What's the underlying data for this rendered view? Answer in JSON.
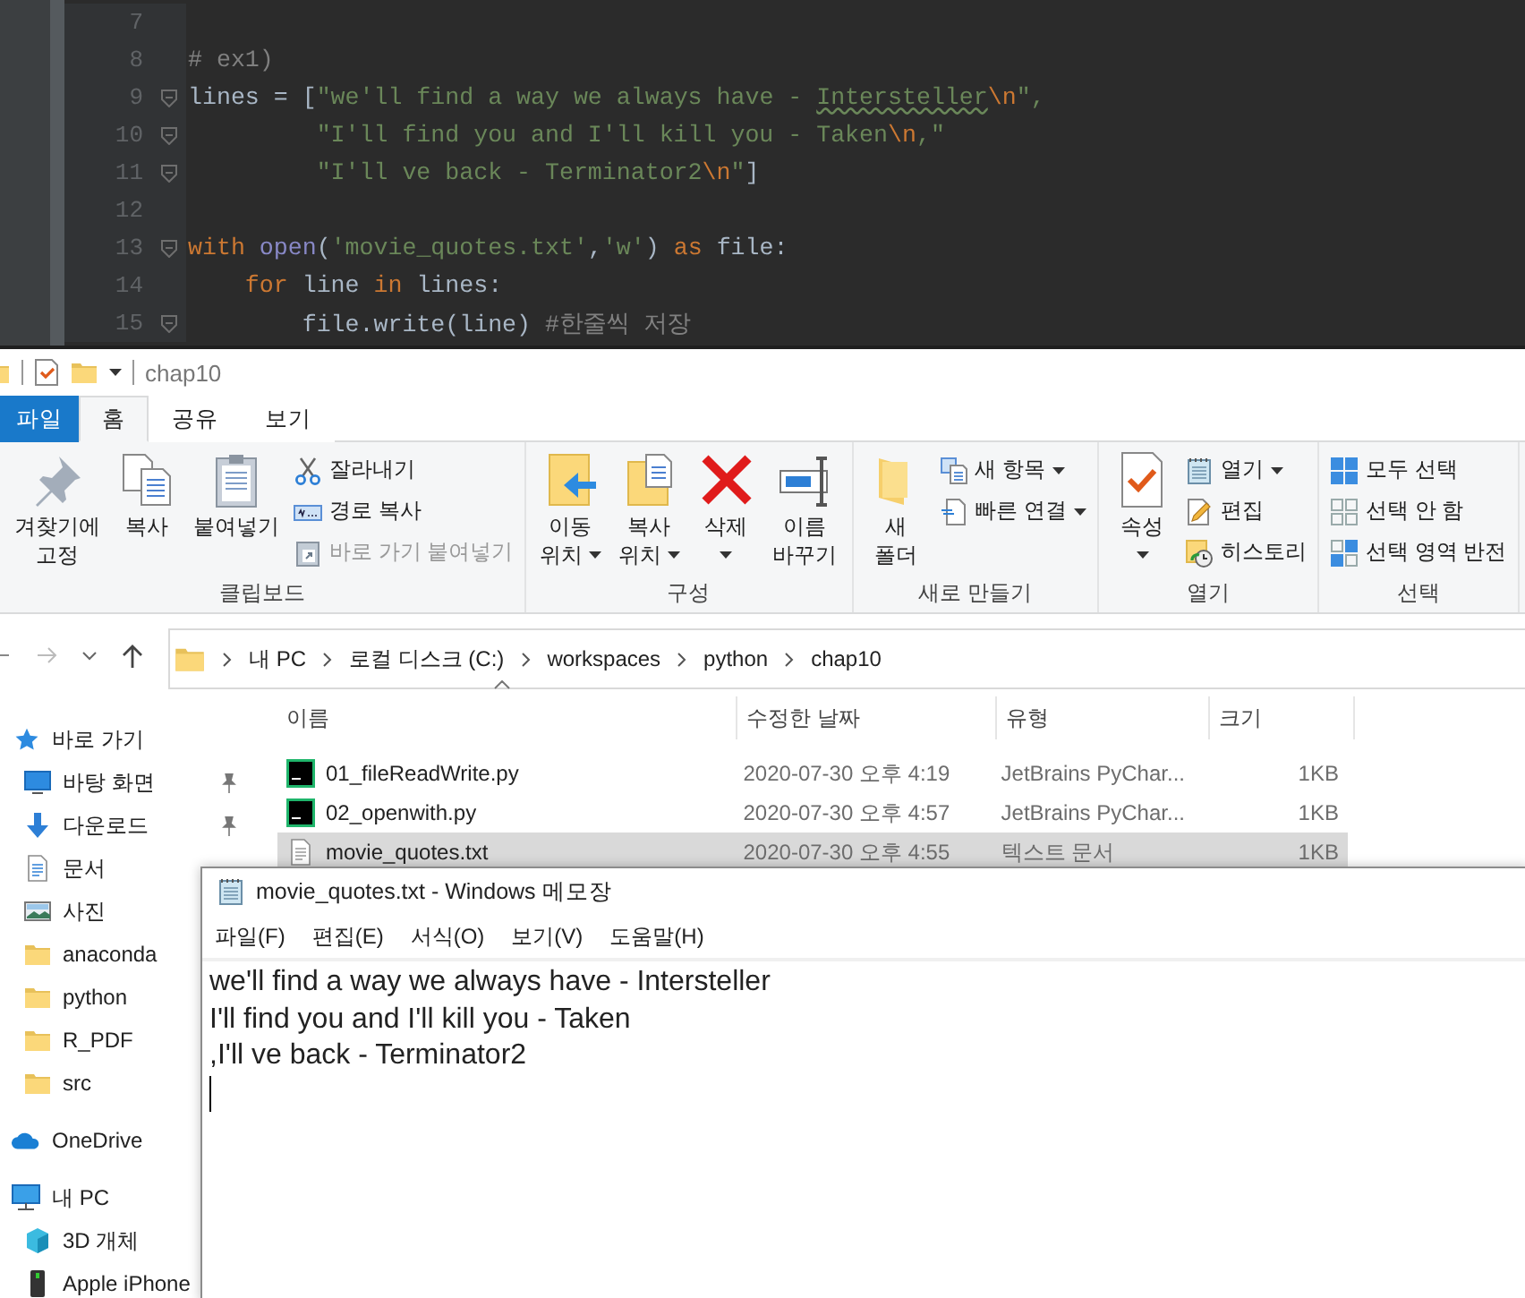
{
  "editor": {
    "lines": [
      {
        "number": "7",
        "fold": false
      },
      {
        "number": "8",
        "fold": false,
        "segments": [
          {
            "kind": "comment",
            "text": "# ex1)"
          }
        ]
      },
      {
        "number": "9",
        "fold": true,
        "segments": [
          {
            "kind": "plain",
            "text": "lines = ["
          },
          {
            "kind": "string",
            "text": "\"we'll find a way we always have - "
          },
          {
            "kind": "typo",
            "text": "Intersteller"
          },
          {
            "kind": "escape",
            "text": "\\n"
          },
          {
            "kind": "string",
            "text": "\","
          }
        ]
      },
      {
        "number": "10",
        "fold": true,
        "segments": [
          {
            "kind": "string",
            "text": "         \"I'll find you and I'll kill you - Taken"
          },
          {
            "kind": "escape",
            "text": "\\n"
          },
          {
            "kind": "string",
            "text": ",\""
          }
        ]
      },
      {
        "number": "11",
        "fold": true,
        "segments": [
          {
            "kind": "string",
            "text": "         \"I'll ve back - Terminator2"
          },
          {
            "kind": "escape",
            "text": "\\n"
          },
          {
            "kind": "string",
            "text": "\""
          },
          {
            "kind": "plain",
            "text": "]"
          }
        ]
      },
      {
        "number": "12",
        "fold": false
      },
      {
        "number": "13",
        "fold": true,
        "segments": [
          {
            "kind": "keyword",
            "text": "with "
          },
          {
            "kind": "builtin",
            "text": "open"
          },
          {
            "kind": "plain",
            "text": "("
          },
          {
            "kind": "string",
            "text": "'movie_quotes.txt'"
          },
          {
            "kind": "plain",
            "text": ","
          },
          {
            "kind": "string",
            "text": "'w'"
          },
          {
            "kind": "plain",
            "text": ") "
          },
          {
            "kind": "keyword",
            "text": "as "
          },
          {
            "kind": "plain",
            "text": "file:"
          }
        ]
      },
      {
        "number": "14",
        "fold": false,
        "segments": [
          {
            "kind": "keyword",
            "text": "    for "
          },
          {
            "kind": "plain",
            "text": "line "
          },
          {
            "kind": "keyword",
            "text": "in "
          },
          {
            "kind": "plain",
            "text": "lines:"
          }
        ]
      },
      {
        "number": "15",
        "fold": true,
        "segments": [
          {
            "kind": "plain",
            "text": "        file.write(line) "
          },
          {
            "kind": "comment",
            "text": "#한줄씩 저장"
          }
        ]
      }
    ]
  },
  "explorer": {
    "title": "chap10",
    "tabs": [
      {
        "label": "파일",
        "kind": "file",
        "selected": false
      },
      {
        "label": "홈",
        "kind": "tab",
        "selected": true
      },
      {
        "label": "공유",
        "kind": "tab",
        "selected": false
      },
      {
        "label": "보기",
        "kind": "tab",
        "selected": false
      }
    ],
    "ribbon": [
      {
        "label": "클립보드",
        "large": [
          {
            "lines": [
              "겨찾기에",
              "고정"
            ],
            "dropdown": false
          },
          {
            "lines": [
              "복사"
            ],
            "dropdown": false
          },
          {
            "lines": [
              "붙여넣기"
            ],
            "dropdown": false
          }
        ],
        "small": [
          {
            "label": "잘라내기",
            "disabled": false,
            "dropdown": false
          },
          {
            "label": "경로 복사",
            "disabled": false,
            "dropdown": false
          },
          {
            "label": "바로 가기 붙여넣기",
            "disabled": true,
            "dropdown": false
          }
        ]
      },
      {
        "label": "구성",
        "large": [
          {
            "lines": [
              "이동",
              "위치"
            ],
            "dropdown": true
          },
          {
            "lines": [
              "복사",
              "위치"
            ],
            "dropdown": true
          },
          {
            "lines": [
              "삭제"
            ],
            "dropdown": true
          },
          {
            "lines": [
              "이름",
              "바꾸기"
            ],
            "dropdown": false
          }
        ]
      },
      {
        "label": "새로 만들기",
        "large": [
          {
            "lines": [
              "새",
              "폴더"
            ],
            "dropdown": false
          }
        ],
        "small": [
          {
            "label": "새 항목",
            "disabled": false,
            "dropdown": true
          },
          {
            "label": "빠른 연결",
            "disabled": false,
            "dropdown": true
          }
        ]
      },
      {
        "label": "열기",
        "large": [
          {
            "lines": [
              "속성"
            ],
            "dropdown": true
          }
        ],
        "small": [
          {
            "label": "열기",
            "disabled": false,
            "dropdown": true
          },
          {
            "label": "편집",
            "disabled": false,
            "dropdown": false
          },
          {
            "label": "히스토리",
            "disabled": false,
            "dropdown": false
          }
        ]
      },
      {
        "label": "선택",
        "small": [
          {
            "label": "모두 선택",
            "disabled": false,
            "dropdown": false
          },
          {
            "label": "선택 안 함",
            "disabled": false,
            "dropdown": false
          },
          {
            "label": "선택 영역 반전",
            "disabled": false,
            "dropdown": false
          }
        ]
      }
    ],
    "breadcrumb": [
      "내 PC",
      "로컬 디스크 (C:)",
      "workspaces",
      "python",
      "chap10"
    ],
    "sidebar": [
      {
        "label": "바로 가기",
        "kind": "root",
        "pinned": false
      },
      {
        "label": "바탕 화면",
        "kind": "child",
        "pinned": true
      },
      {
        "label": "다운로드",
        "kind": "child",
        "pinned": true
      },
      {
        "label": "문서",
        "kind": "child",
        "pinned": false
      },
      {
        "label": "사진",
        "kind": "child"
      },
      {
        "label": "anaconda",
        "kind": "child"
      },
      {
        "label": "python",
        "kind": "child"
      },
      {
        "label": "R_PDF",
        "kind": "child"
      },
      {
        "label": "src",
        "kind": "child"
      },
      {
        "label": "OneDrive",
        "kind": "root"
      },
      {
        "label": "내 PC",
        "kind": "root"
      },
      {
        "label": "3D 개체",
        "kind": "child"
      },
      {
        "label": "Apple iPhone",
        "kind": "child"
      }
    ],
    "columns": [
      "이름",
      "수정한 날짜",
      "유형",
      "크기"
    ],
    "files": [
      {
        "name": "01_fileReadWrite.py",
        "date": "2020-07-30 오후 4:19",
        "type": "JetBrains PyChar...",
        "size": "1KB",
        "selected": false
      },
      {
        "name": "02_openwith.py",
        "date": "2020-07-30 오후 4:57",
        "type": "JetBrains PyChar...",
        "size": "1KB",
        "selected": false
      },
      {
        "name": "movie_quotes.txt",
        "date": "2020-07-30 오후 4:55",
        "type": "텍스트 문서",
        "size": "1KB",
        "selected": true
      }
    ]
  },
  "notepad": {
    "title": "movie_quotes.txt - Windows 메모장",
    "menu": [
      "파일(F)",
      "편집(E)",
      "서식(O)",
      "보기(V)",
      "도움말(H)"
    ],
    "lines": [
      "we'll find a way we always have - Intersteller",
      "I'll find you and I'll kill you - Taken",
      ",I'll ve back - Terminator2"
    ]
  }
}
